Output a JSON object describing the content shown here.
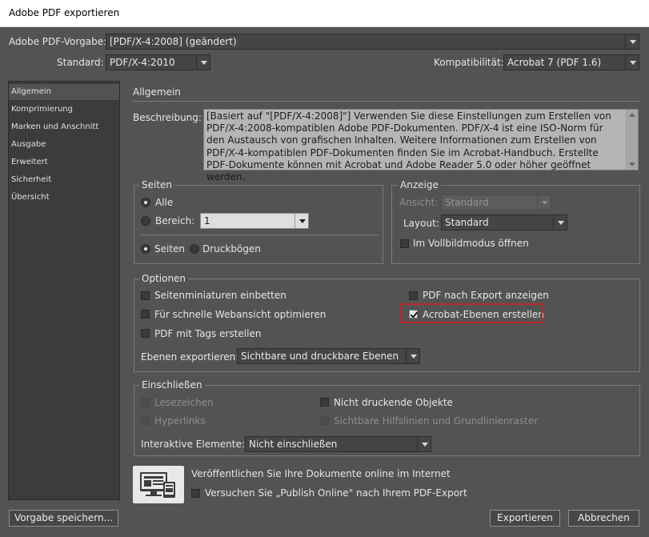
{
  "window": {
    "title": "Adobe PDF exportieren"
  },
  "header": {
    "preset_label": "Adobe PDF-Vorgabe:",
    "preset_value": "[PDF/X-4:2008] (geändert)",
    "standard_label": "Standard:",
    "standard_value": "PDF/X-4:2010",
    "compat_label": "Kompatibilität:",
    "compat_value": "Acrobat 7 (PDF 1.6)"
  },
  "sidebar": {
    "items": [
      {
        "label": "Allgemein",
        "active": true
      },
      {
        "label": "Komprimierung"
      },
      {
        "label": "Marken und Anschnitt"
      },
      {
        "label": "Ausgabe"
      },
      {
        "label": "Erweitert"
      },
      {
        "label": "Sicherheit"
      },
      {
        "label": "Übersicht"
      }
    ]
  },
  "main": {
    "section_title": "Allgemein",
    "description_label": "Beschreibung:",
    "description_text": "[Basiert auf \"[PDF/X-4:2008]\"] Verwenden Sie diese Einstellungen zum Erstellen von PDF/X-4:2008-kompatiblen Adobe PDF-Dokumenten. PDF/X-4 ist eine ISO-Norm für den Austausch von grafischen Inhalten. Weitere Informationen zum Erstellen von PDF/X-4-kompatiblen PDF-Dokumenten finden Sie im Acrobat-Handbuch. Erstellte PDF-Dokumente können mit Acrobat und Adobe Reader 5.0 oder höher geöffnet werden."
  },
  "pages": {
    "title": "Seiten",
    "all_label": "Alle",
    "range_label": "Bereich:",
    "range_value": "1",
    "pages_label": "Seiten",
    "spreads_label": "Druckbögen"
  },
  "view": {
    "title": "Anzeige",
    "view_label": "Ansicht:",
    "view_value": "Standard",
    "layout_label": "Layout:",
    "layout_value": "Standard",
    "fullscreen_label": "Im Vollbildmodus öffnen"
  },
  "options": {
    "title": "Optionen",
    "thumbnails_label": "Seitenminiaturen einbetten",
    "fastweb_label": "Für schnelle Webansicht optimieren",
    "tagged_label": "PDF mit Tags erstellen",
    "view_after_label": "PDF nach Export anzeigen",
    "layers_label": "Acrobat-Ebenen erstellen",
    "export_layers_label": "Ebenen exportieren:",
    "export_layers_value": "Sichtbare und druckbare Ebenen"
  },
  "include": {
    "title": "Einschließen",
    "bookmarks_label": "Lesezeichen",
    "hyperlinks_label": "Hyperlinks",
    "nonprinting_label": "Nicht druckende Objekte",
    "guides_label": "Sichtbare Hilfslinien und Grundlinienraster",
    "interactive_label": "Interaktive Elemente:",
    "interactive_value": "Nicht einschließen"
  },
  "publish": {
    "headline": "Veröffentlichen Sie Ihre Dokumente online im Internet",
    "checkbox_label": "Versuchen Sie „Publish Online\" nach Ihrem PDF-Export"
  },
  "footer": {
    "save_preset": "Vorgabe speichern...",
    "export": "Exportieren",
    "cancel": "Abbrechen"
  },
  "colors": {
    "highlight": "#c1272d",
    "background": "#535353"
  }
}
